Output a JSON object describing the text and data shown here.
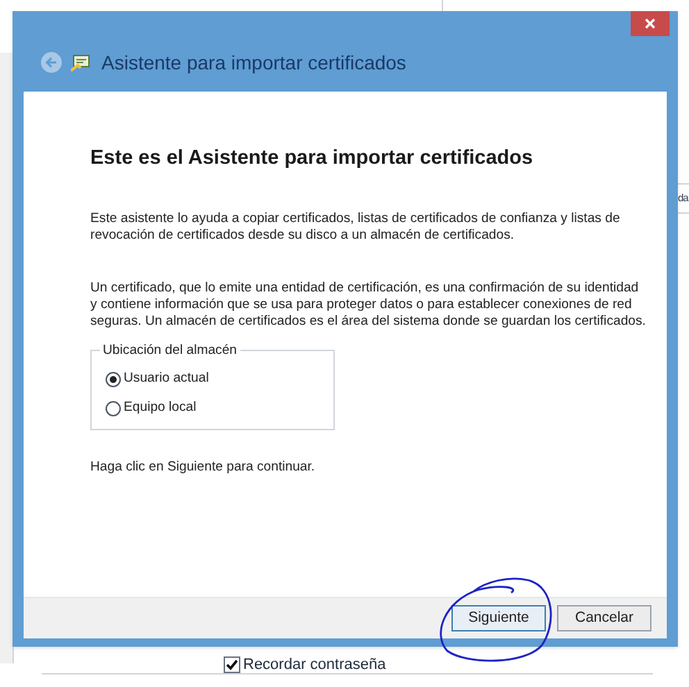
{
  "background": {
    "cut_text": "da",
    "remember_password": {
      "label": "Recordar contraseña",
      "checked": true
    }
  },
  "dialog": {
    "title": "Asistente para importar certificados",
    "heading": "Este es el Asistente para importar certificados",
    "paragraphs": [
      "Este asistente lo ayuda a copiar certificados, listas de certificados de confianza y listas de revocación de certificados desde su disco a un almacén de certificados.",
      "Un certificado, que lo emite una entidad de certificación, es una confirmación de su identidad y contiene información que se usa para proteger datos o para establecer conexiones de red seguras. Un almacén de certificados es el área del sistema donde se guardan los certificados."
    ],
    "store_location": {
      "legend": "Ubicación del almacén",
      "options": [
        {
          "label": "Usuario actual",
          "selected": true
        },
        {
          "label": "Equipo local",
          "selected": false
        }
      ]
    },
    "hint": "Haga clic en Siguiente para continuar.",
    "buttons": [
      {
        "label": "Siguiente",
        "kind": "default"
      },
      {
        "label": "Cancelar",
        "kind": "normal"
      }
    ]
  }
}
